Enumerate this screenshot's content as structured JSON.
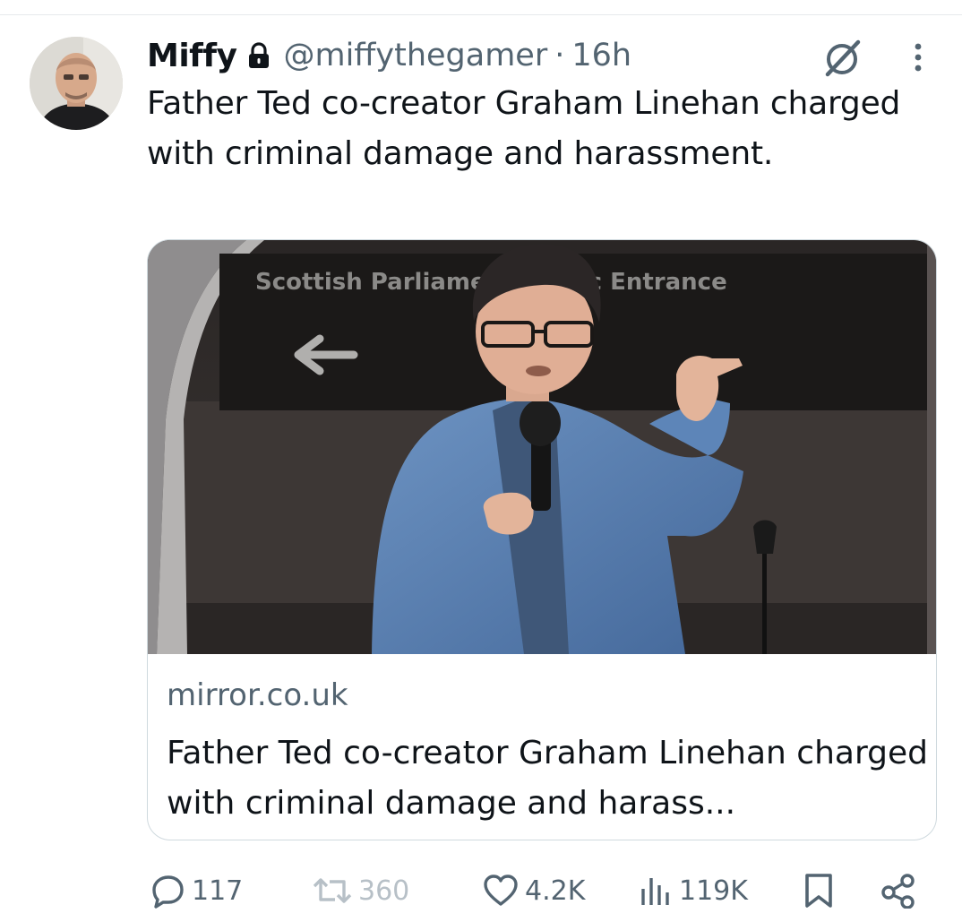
{
  "tweet": {
    "display_name": "Miffy",
    "handle": "@miffythegamer",
    "separator": "·",
    "time": "16h",
    "text": "Father Ted co-creator Graham Linehan charged with criminal damage and harassment."
  },
  "card": {
    "image_sign_text": "Scottish Parliament Public Entrance",
    "domain": "mirror.co.uk",
    "title": "Father Ted co-creator Graham Linehan charged with criminal damage and harass..."
  },
  "actions": {
    "replies": "117",
    "retweets": "360",
    "likes": "4.2K",
    "views": "119K"
  },
  "icons": {
    "lock": "lock-icon",
    "grok": "grok-icon",
    "more": "more-icon",
    "reply": "reply-icon",
    "retweet": "retweet-icon",
    "like": "heart-icon",
    "views": "views-icon",
    "bookmark": "bookmark-icon",
    "share": "share-icon"
  },
  "colors": {
    "text": "#0f1419",
    "secondary": "#536471",
    "border": "#cfd9de",
    "retweet_disabled": "#b7c0c7"
  }
}
